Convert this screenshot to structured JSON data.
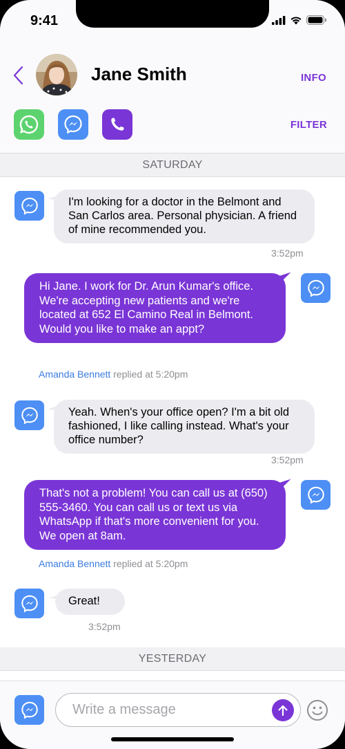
{
  "status": {
    "time": "9:41"
  },
  "header": {
    "contact_name": "Jane Smith",
    "info_label": "INFO",
    "filter_label": "FILTER"
  },
  "colors": {
    "accent": "#7a35d6",
    "messenger": "#4d8ff4",
    "whatsapp": "#5dd36f",
    "link": "#3b7ce0"
  },
  "channels": [
    "whatsapp-icon",
    "messenger-icon",
    "phone-icon"
  ],
  "days": {
    "saturday": "SATURDAY",
    "yesterday": "YESTERDAY"
  },
  "messages": [
    {
      "direction": "in",
      "text": "I'm looking for a doctor in the  Belmont and San Carlos area. Personal physician. A friend of mine recommended you.",
      "time": "3:52pm"
    },
    {
      "direction": "out",
      "text": "Hi Jane. I work for Dr. Arun Kumar's office. We're accepting new patients and we're located at 652 El Camino Real in Belmont. Would you like to make an appt?",
      "replier": "Amanda Bennett",
      "replied_text": "replied at 5:20pm"
    },
    {
      "direction": "in",
      "text": "Yeah. When's your office open? I'm a bit old fashioned, I like calling instead. What's your office number?",
      "time": "3:52pm"
    },
    {
      "direction": "out",
      "text": "That's not a problem! You can call us at (650) 555-3460. You can call us or text us via WhatsApp if that's more convenient for you. We open at 8am.",
      "replier": "Amanda Bennett",
      "replied_text": "replied at 5:20pm"
    },
    {
      "direction": "in",
      "text": "Great!",
      "time": "3:52pm"
    }
  ],
  "composer": {
    "placeholder": "Write a message"
  }
}
